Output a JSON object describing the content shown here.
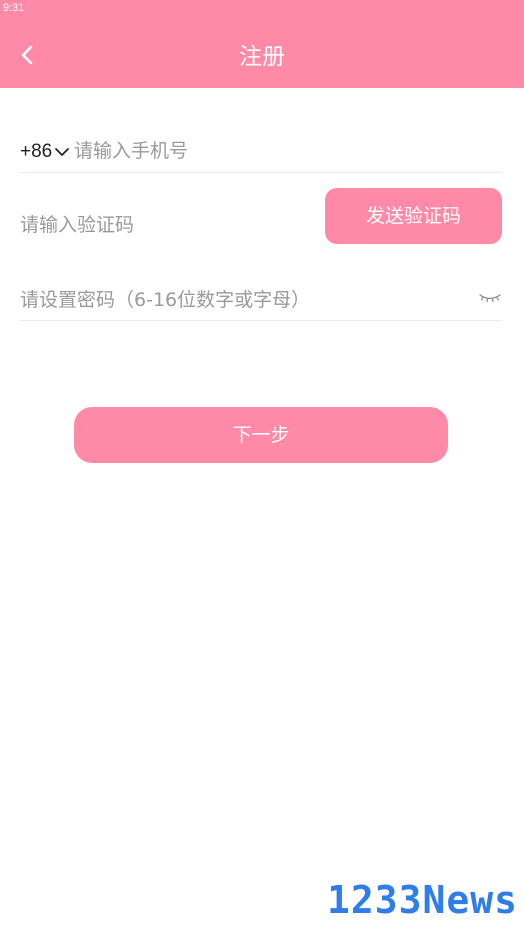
{
  "status_bar": {
    "time": "9:31"
  },
  "header": {
    "title": "注册",
    "back_icon": "chevron-left-icon"
  },
  "form": {
    "country_code": "+86",
    "phone": {
      "placeholder": "请输入手机号",
      "value": ""
    },
    "code": {
      "placeholder": "请输入验证码",
      "value": ""
    },
    "send_code_label": "发送验证码",
    "password": {
      "placeholder": "请设置密码（6-16位数字或字母）",
      "value": ""
    },
    "password_toggle_icon": "eye-closed-icon"
  },
  "next_label": "下一步",
  "watermark": "1233News",
  "colors": {
    "accent": "#ff8aa8",
    "divider": "#fbe3ea",
    "placeholder": "#9a9a9a",
    "watermark": "#2f7de8"
  }
}
